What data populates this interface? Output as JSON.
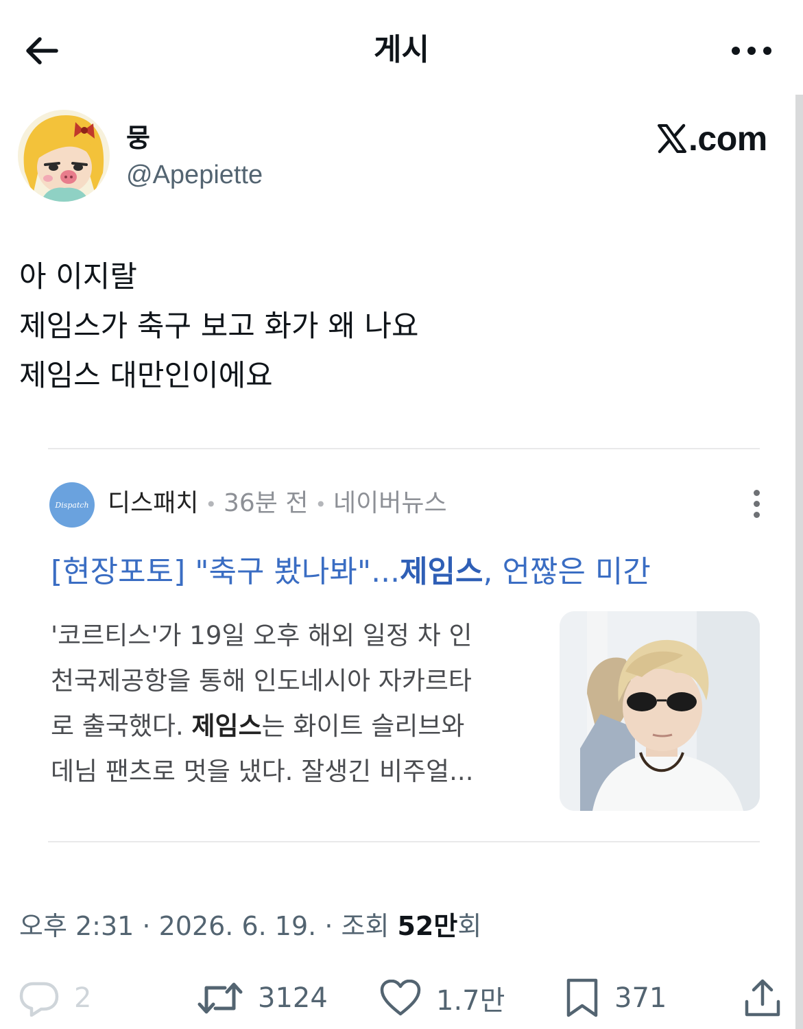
{
  "header": {
    "title": "게시",
    "back_icon": "arrow-left-icon",
    "more_icon": "more-horizontal-icon"
  },
  "author": {
    "name": "뭉",
    "handle": "@Apepiette",
    "watermark": "X.com"
  },
  "post": {
    "lines": [
      "아 이지랄",
      "제임스가 축구 보고 화가 왜 나요",
      "제임스 대만인이에요"
    ]
  },
  "card": {
    "logo_text": "Dispatch",
    "source": "디스패치",
    "time": "36분 전",
    "platform": "네이버뉴스",
    "title_prefix": "[현장포토] \"축구 봤나봐\"...",
    "title_bold": "제임스",
    "title_suffix": ", 언짢은 미간",
    "body_line1": "'코르티스'가 19일 오후 해외 일정 차 인",
    "body_line2": "천국제공항을 통해 인도네시아 자카르타",
    "body_line3_prefix": "로 출국했다. ",
    "body_line3_bold": "제임스",
    "body_line3_suffix": "는 화이트 슬리브와",
    "body_line4": "데님 팬츠로 멋을 냈다. 잘생긴 비주얼..."
  },
  "meta": {
    "time": "오후 2:31",
    "sep1": " · ",
    "date": "2026. 6. 19.",
    "sep2": " · ",
    "views_label": "조회 ",
    "views_value": "52만",
    "views_unit": "회"
  },
  "actions": {
    "replies": "2",
    "retweets": "3124",
    "likes": "1.7만",
    "bookmarks": "371"
  },
  "colors": {
    "link_blue": "#3a6dc3",
    "secondary_text": "#536471",
    "dispatch_logo": "#6aa2de"
  }
}
